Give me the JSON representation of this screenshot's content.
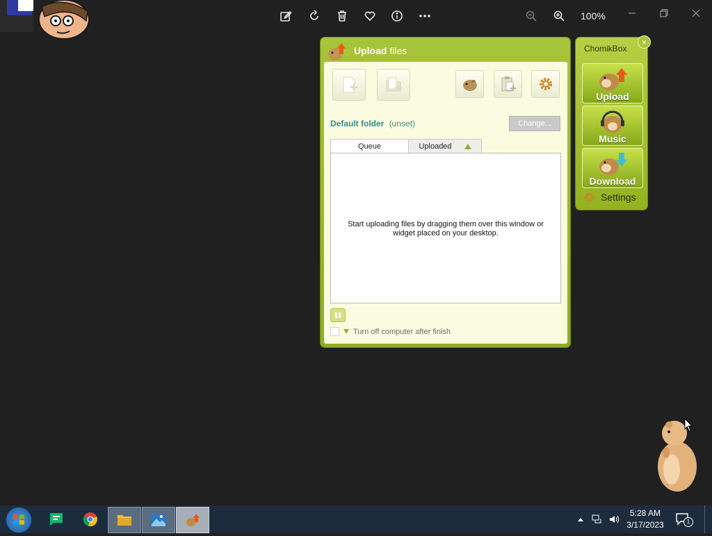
{
  "viewer": {
    "zoom_label": "100%"
  },
  "upload_window": {
    "title_bold": "Upload",
    "title_rest": " files",
    "default_folder_label": "Default folder",
    "default_folder_value": "(unset)",
    "change_button": "Change...",
    "tabs": [
      {
        "label": "Queue"
      },
      {
        "label": "Uploaded"
      }
    ],
    "empty_message": "Start uploading files by dragging them over this window or widget placed on your desktop.",
    "shutdown_label": "Turn off computer after finish"
  },
  "chomikbox": {
    "title": "ChomikBox",
    "close": "×",
    "buttons": [
      {
        "label": "Upload"
      },
      {
        "label": "Music"
      },
      {
        "label": "Download"
      }
    ],
    "settings_label": "Settings"
  },
  "taskbar": {
    "time": "5:28 AM",
    "date": "3/17/2023",
    "notification_count": "1"
  },
  "colors": {
    "accent_green": "#9bb82a",
    "panel_bg": "#fbfcdf",
    "desktop_bg": "#202020",
    "taskbar_bg": "#1c2c3c"
  }
}
